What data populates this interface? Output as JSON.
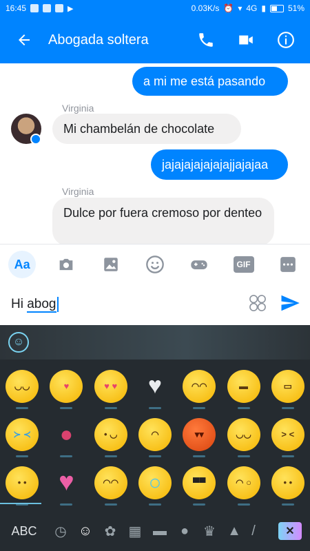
{
  "status_bar": {
    "time": "16:45",
    "network_speed": "0.03K/s",
    "network_type": "4G",
    "battery": "51%"
  },
  "app_bar": {
    "title": "Abogada soltera",
    "back_icon": "arrow-left-icon",
    "call_icon": "phone-icon",
    "video_icon": "video-camera-icon",
    "info_icon": "info-icon"
  },
  "messages": [
    {
      "direction": "outgoing",
      "sender": "",
      "text": "a mi me está pasando"
    },
    {
      "direction": "incoming",
      "sender": "Virginia",
      "text": "Mi chambelán de chocolate"
    },
    {
      "direction": "outgoing",
      "sender": "",
      "text": "jajajajajajajajjajajaa"
    },
    {
      "direction": "incoming",
      "sender": "Virginia",
      "text": "Dulce por fuera cremoso por denteo"
    }
  ],
  "composer": {
    "tools": [
      "Aa",
      "camera-icon",
      "image-icon",
      "emoji-icon",
      "gamepad-icon",
      "GIF",
      "more-icon"
    ],
    "input_prefix": "Hi ",
    "input_underlined": "abog",
    "sticker_icon": "emoji-faces-icon",
    "send_icon": "send-icon"
  },
  "keyboard": {
    "switch_label": "ABC",
    "categories": [
      "recent-icon",
      "smiley-icon",
      "flower-icon",
      "cake-icon",
      "car-icon",
      "ball-icon",
      "crown-icon",
      "triangle-icon",
      "slash-icon"
    ],
    "delete_icon": "backspace-icon",
    "emoji_rows": [
      [
        "grinning-face",
        "kissing-face",
        "heart-eyes-face",
        "white-heart",
        "smiling-face",
        "grinning-squint-face",
        "beaming-face"
      ],
      [
        "crying-laughing-face",
        "kiss-lips",
        "winking-face",
        "sad-face",
        "devil-face",
        "laughing-face",
        "squinting-face"
      ],
      [
        "smiling-face",
        "sparkling-heart",
        "smiling-eyes-face",
        "halo-face",
        "sunglasses-face",
        "whistling-face",
        "big-smile-face"
      ]
    ]
  },
  "colors": {
    "accent": "#0084ff",
    "keyboard_bg": "#252b30"
  }
}
